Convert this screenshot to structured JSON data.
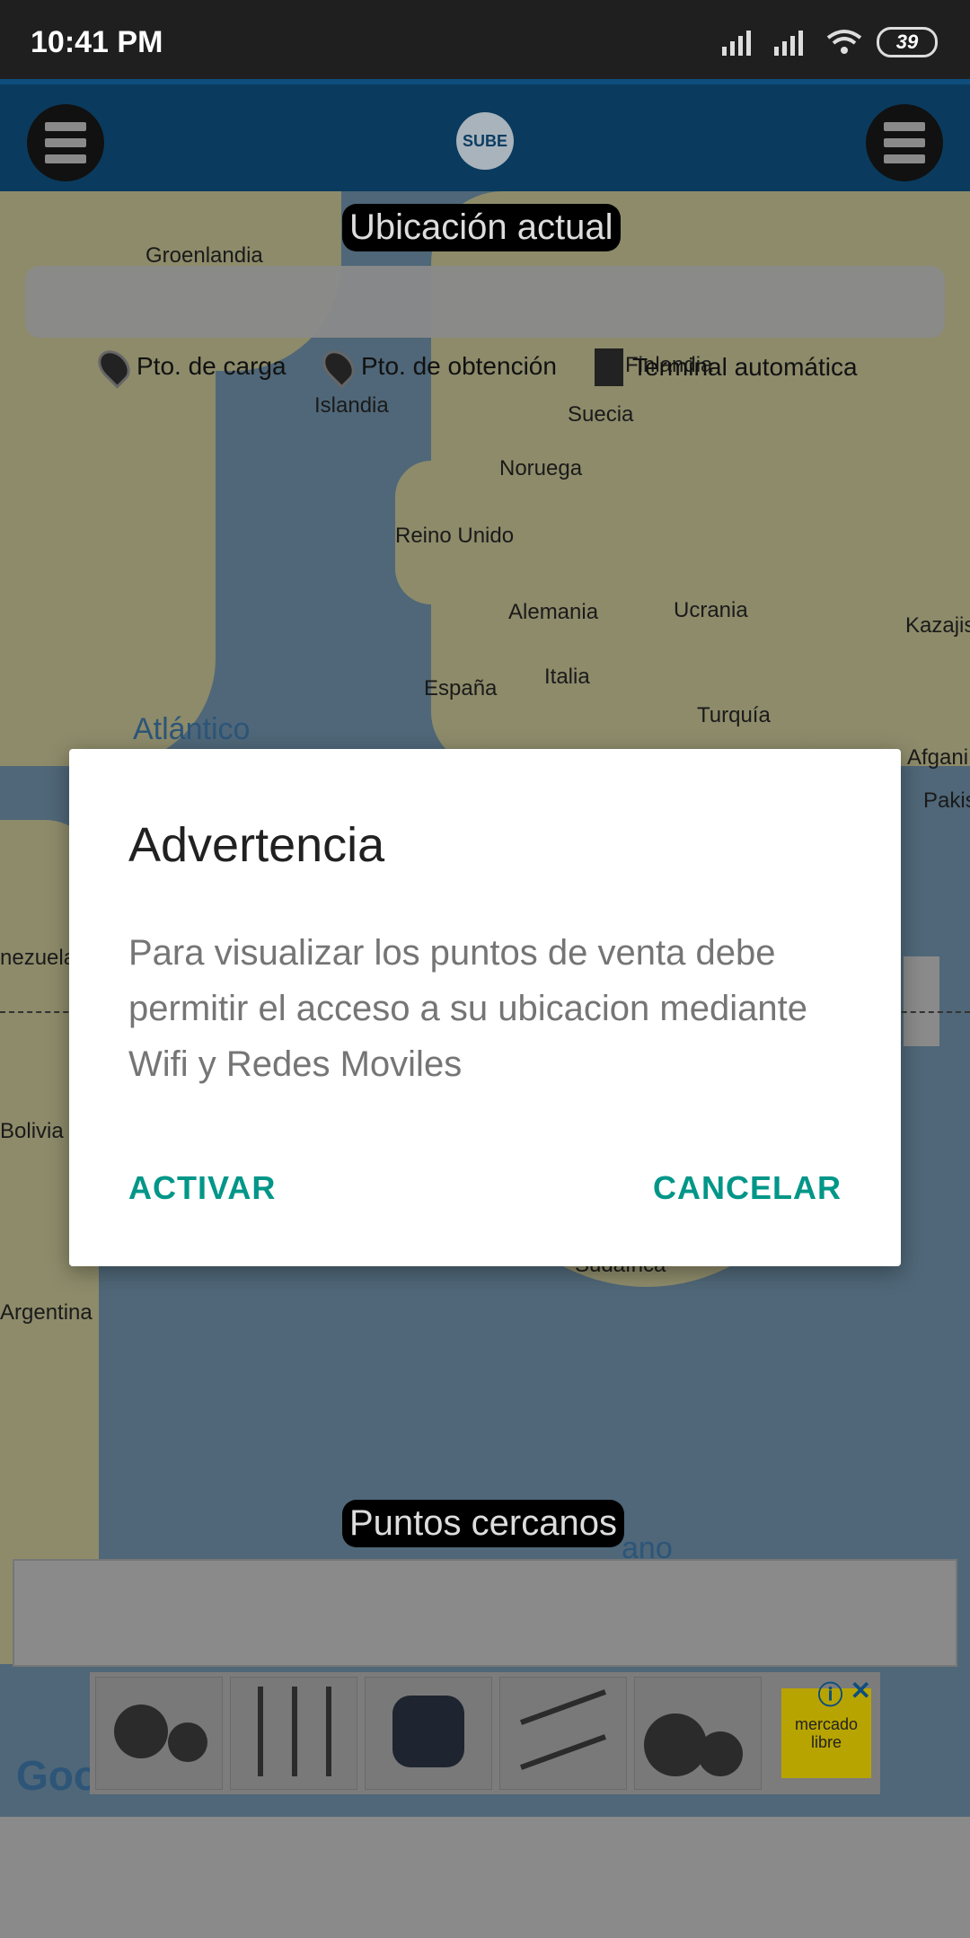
{
  "status_bar": {
    "time": "10:41 PM",
    "battery": "39"
  },
  "app_bar": {
    "logo_text": "SUBE"
  },
  "map": {
    "current_location_label": "Ubicación actual",
    "nearby_label": "Puntos cercanos",
    "places": [
      "Groenlandia",
      "Islandia",
      "Suecia",
      "Finlandia",
      "Noruega",
      "Reino Unido",
      "Alemania",
      "Ucrania",
      "Kazajis",
      "España",
      "Italia",
      "Turquía",
      "Afgani",
      "Pakis",
      "nezuela",
      "Bolivia",
      "Argentina",
      "Sudáfrica"
    ],
    "ocean": "Atlántico",
    "ocean_partial": "ano",
    "google": "Goo"
  },
  "legend": {
    "charge": "Pto. de carga",
    "obtain": "Pto. de obtención",
    "terminal": "Terminal automática"
  },
  "dialog": {
    "title": "Advertencia",
    "message": "Para visualizar los puntos de venta debe permitir el acceso a su ubicacion mediante Wifi y Redes Moviles",
    "activate": "ACTIVAR",
    "cancel": "CANCELAR"
  },
  "ad": {
    "brand": "mercado libre"
  }
}
